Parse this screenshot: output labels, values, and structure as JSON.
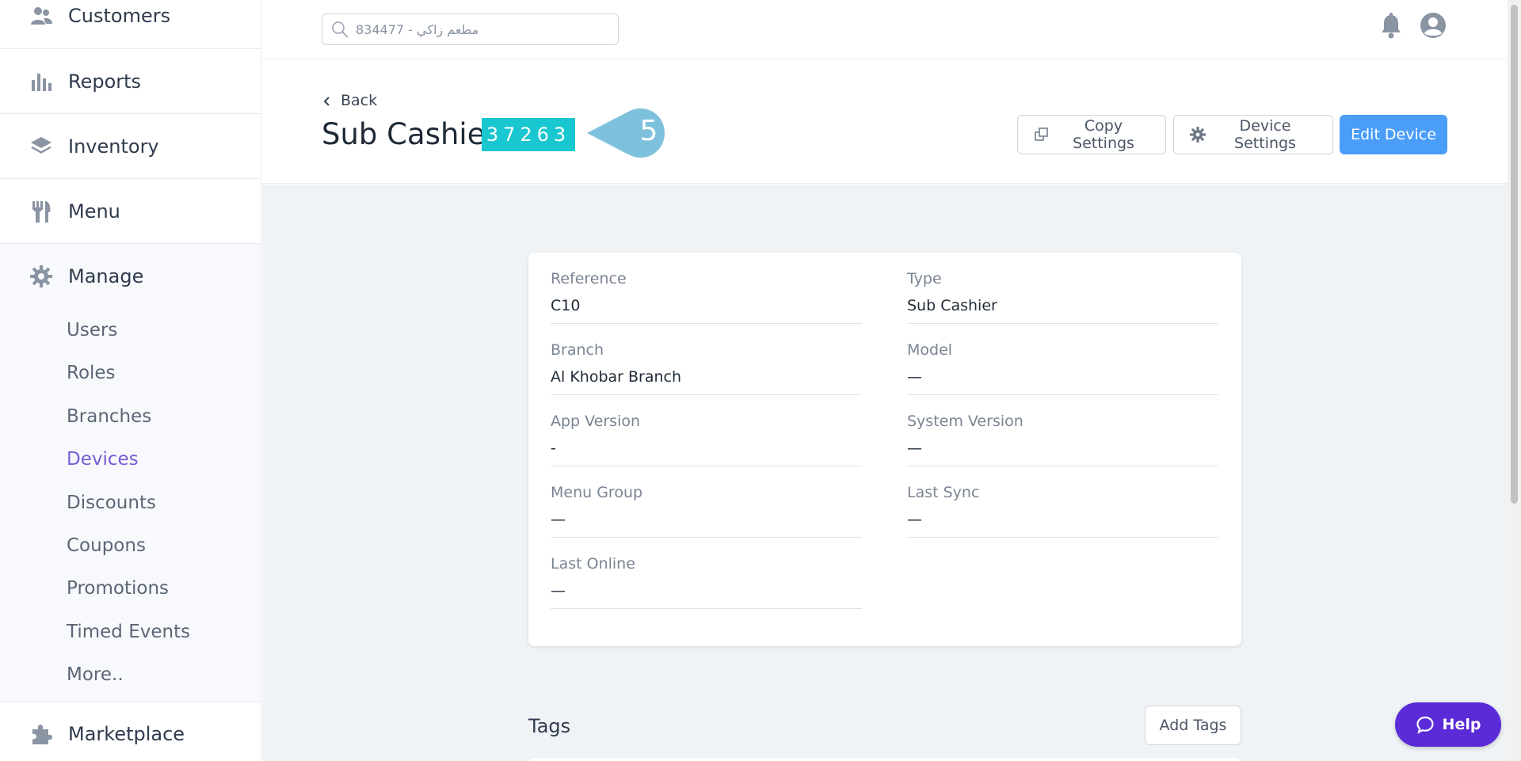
{
  "sidebar": {
    "items": [
      {
        "label": "Customers",
        "icon": "users-icon"
      },
      {
        "label": "Reports",
        "icon": "bar-chart-icon"
      },
      {
        "label": "Inventory",
        "icon": "layers-icon"
      },
      {
        "label": "Menu",
        "icon": "utensils-icon"
      }
    ],
    "manage": {
      "label": "Manage",
      "icon": "gear-icon",
      "subitems": [
        "Users",
        "Roles",
        "Branches",
        "Devices",
        "Discounts",
        "Coupons",
        "Promotions",
        "Timed Events",
        "More.."
      ],
      "active": "Devices"
    },
    "marketplace": {
      "label": "Marketplace",
      "icon": "puzzle-icon"
    }
  },
  "topbar": {
    "search_placeholder": "مطعم زاكي - 834477"
  },
  "header": {
    "back_label": "Back",
    "title": "Sub Cashier",
    "badge": "37263",
    "pointer_number": "5",
    "copy_settings_label": "Copy Settings",
    "device_settings_label": "Device Settings",
    "edit_device_label": "Edit Device"
  },
  "details": {
    "reference": {
      "label": "Reference",
      "value": "C10"
    },
    "type": {
      "label": "Type",
      "value": "Sub Cashier"
    },
    "branch": {
      "label": "Branch",
      "value": "Al Khobar Branch"
    },
    "model": {
      "label": "Model",
      "value": "—"
    },
    "app_version": {
      "label": "App Version",
      "value": "-"
    },
    "system_version": {
      "label": "System Version",
      "value": "—"
    },
    "menu_group": {
      "label": "Menu Group",
      "value": "—"
    },
    "last_sync": {
      "label": "Last Sync",
      "value": "—"
    },
    "last_online": {
      "label": "Last Online",
      "value": "—"
    }
  },
  "tags": {
    "title": "Tags",
    "add_label": "Add Tags"
  },
  "help_label": "Help",
  "colors": {
    "accent": "#4a9df8",
    "badge": "#19c7d0",
    "pointer": "#7ec1dc",
    "help": "#5b2bd8",
    "active_nav": "#7a5cd6"
  }
}
